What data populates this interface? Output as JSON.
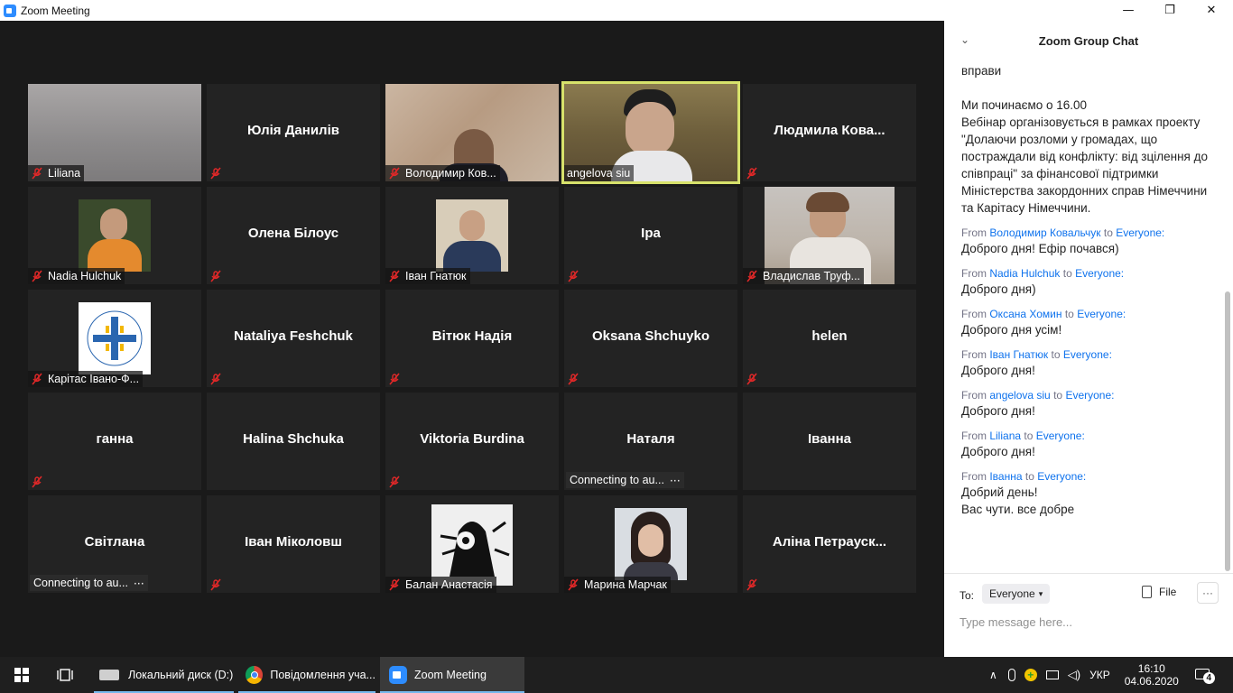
{
  "window": {
    "title": "Zoom Meeting",
    "minimize": "—",
    "restore": "❐",
    "close": "✕"
  },
  "tiles": {
    "r1c1": "Liliana",
    "r1c2": "Юлія Данилів",
    "r1c3": "Володимир Ков...",
    "r1c4": "angelova siu",
    "r1c5": "Людмила  Кова...",
    "r2c1": "Nadia Hulchuk",
    "r2c2": "Олена Білоус",
    "r2c3": "Іван Гнатюк",
    "r2c4": "Іра",
    "r2c5": "Владислав Труф...",
    "r3c1": "Карітас Івано-Ф...",
    "r3c2": "Nataliya Feshchuk",
    "r3c3": "Вітюк Надія",
    "r3c4": "Oksana Shchuyko",
    "r3c5": "helen",
    "r4c1": "ганна",
    "r4c2": "Halina Shchuka",
    "r4c3": "Viktoria Burdina",
    "r4c4": "Наталя",
    "r4c4_status": "Connecting to au...",
    "r4c5": "Іванна",
    "r5c1": "Світлана",
    "r5c1_status": "Connecting to au...",
    "r5c2": "Іван Міколовш",
    "r5c3": "Балан Анастасія",
    "r5c4": "Марина Марчак",
    "r5c5": "Аліна  Петрауск...",
    "caritas_logo_text": "Карітас України м.Івано-Франківськ"
  },
  "chat": {
    "title": "Zoom Group Chat",
    "collapse_icon": "⌄",
    "partial_top": "вправи",
    "msg0_line1": "Ми починаємо о 16.00",
    "msg0_line2": "Вебінар організовується в рамках проекту \"Долаючи розломи у громадах, що постраждали від конфлікту: від зцілення до співпраці\" за фінансової підтримки Міністерства закордонних справ Німеччини та Карітасу Німеччини.",
    "from_label": "From",
    "to_label": "to",
    "everyone_label": "Everyone:",
    "messages": [
      {
        "from": "Володимир Ковальчук",
        "text": "Доброго дня! Ефір почався)"
      },
      {
        "from": "Nadia Hulchuk",
        "text": "Доброго дня)"
      },
      {
        "from": "Оксана Хомин",
        "text": "Доброго дня усім!"
      },
      {
        "from": "Іван Гнатюк",
        "text": "Доброго дня!"
      },
      {
        "from": "angelova siu",
        "text": "Доброго дня!"
      },
      {
        "from": "Liliana",
        "text": "Доброго дня!"
      },
      {
        "from": "Іванна",
        "text": "Добрий день!",
        "text2": "Вас чути. все добре"
      }
    ],
    "to_prefix": "To:",
    "recipient": "Everyone",
    "file_label": "File",
    "more_label": "···",
    "input_placeholder": "Type message here..."
  },
  "taskbar": {
    "item1": "Локальний диск (D:)",
    "item2": "Повідомлення уча...",
    "item3": "Zoom Meeting",
    "lang": "УКР",
    "time": "16:10",
    "date": "04.06.2020",
    "notifications": "4"
  },
  "colors": {
    "active_speaker_border": "#d7e26b",
    "mute_red": "#e02828",
    "link_blue": "#0e72ed",
    "taskbar": "#1f1f1f"
  }
}
